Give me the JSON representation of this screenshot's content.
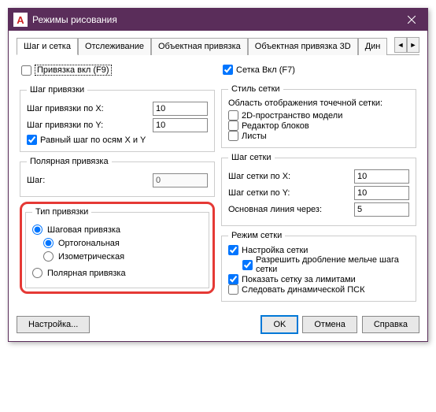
{
  "title": "Режимы рисования",
  "tabs": [
    "Шаг и сетка",
    "Отслеживание",
    "Объектная привязка",
    "Объектная привязка 3D",
    "Дин"
  ],
  "left": {
    "snap_on": "Привязка вкл (F9)",
    "snap_step": {
      "legend": "Шаг привязки",
      "x_label": "Шаг привязки по X:",
      "x_val": "10",
      "y_label": "Шаг привязки по Y:",
      "y_val": "10",
      "equal": "Равный шаг по осям X и Y"
    },
    "polar": {
      "legend": "Полярная привязка",
      "step_label": "Шаг:",
      "step_val": "0"
    },
    "snap_type": {
      "legend": "Тип привязки",
      "step_snap": "Шаговая привязка",
      "ortho": "Ортогональная",
      "iso": "Изометрическая",
      "polar_snap": "Полярная привязка"
    }
  },
  "right": {
    "grid_on": "Сетка Вкл (F7)",
    "grid_style": {
      "legend": "Стиль сетки",
      "desc": "Область отображения точечной сетки:",
      "space2d": "2D-пространство модели",
      "block_ed": "Редактор блоков",
      "sheets": "Листы"
    },
    "grid_step": {
      "legend": "Шаг сетки",
      "x_label": "Шаг сетки по X:",
      "x_val": "10",
      "y_label": "Шаг сетки по Y:",
      "y_val": "10",
      "main_label": "Основная линия через:",
      "main_val": "5"
    },
    "grid_mode": {
      "legend": "Режим сетки",
      "adapt": "Настройка сетки",
      "frac": "Разрешить дробление мельче шага сетки",
      "limits": "Показать сетку за лимитами",
      "ucs": "Следовать динамической ПСК"
    }
  },
  "buttons": {
    "settings": "Настройка...",
    "ok": "OK",
    "cancel": "Отмена",
    "help": "Справка"
  }
}
